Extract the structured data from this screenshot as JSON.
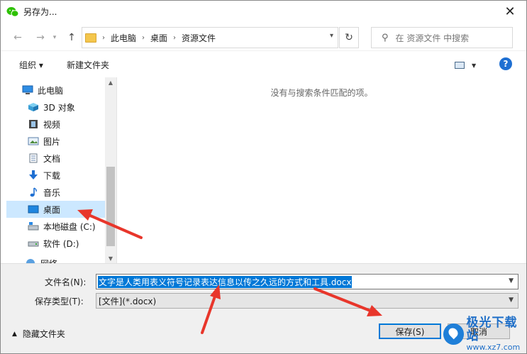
{
  "window": {
    "title": "另存为...",
    "close_glyph": "✕",
    "app_icon": "wechat-icon"
  },
  "address": {
    "crumbs": [
      "此电脑",
      "桌面",
      "资源文件"
    ],
    "search_placeholder": "在 资源文件 中搜索"
  },
  "toolbar": {
    "organize": "组织 ▾",
    "new_folder": "新建文件夹",
    "help": "?"
  },
  "nav": {
    "items": [
      {
        "label": "此电脑",
        "icon": "pc-icon"
      },
      {
        "label": "3D 对象",
        "icon": "3d-objects-icon"
      },
      {
        "label": "视频",
        "icon": "video-icon"
      },
      {
        "label": "图片",
        "icon": "pictures-icon"
      },
      {
        "label": "文档",
        "icon": "documents-icon"
      },
      {
        "label": "下载",
        "icon": "download-icon"
      },
      {
        "label": "音乐",
        "icon": "music-icon"
      },
      {
        "label": "桌面",
        "icon": "desktop-icon",
        "selected": true
      },
      {
        "label": "本地磁盘 (C:)",
        "icon": "local-disk-icon"
      },
      {
        "label": "软件 (D:)",
        "icon": "drive-icon"
      },
      {
        "label": "网络",
        "icon": "network-icon"
      }
    ]
  },
  "content": {
    "empty_message": "没有与搜索条件匹配的项。"
  },
  "form": {
    "filename_label": "文件名(N):",
    "filename_value": "文字是人类用表义符号记录表达信息以传之久远的方式和工具.docx",
    "filetype_label": "保存类型(T):",
    "filetype_value": "[文件](*.docx)",
    "hide_folders": "隐藏文件夹",
    "save_label": "保存(S)",
    "cancel_label": "取消"
  },
  "watermark": {
    "title": "极光下载站",
    "url": "www.xz7.com"
  },
  "colors": {
    "accent": "#0078d7",
    "selection": "#cce8ff",
    "annotation": "#e8362b"
  }
}
